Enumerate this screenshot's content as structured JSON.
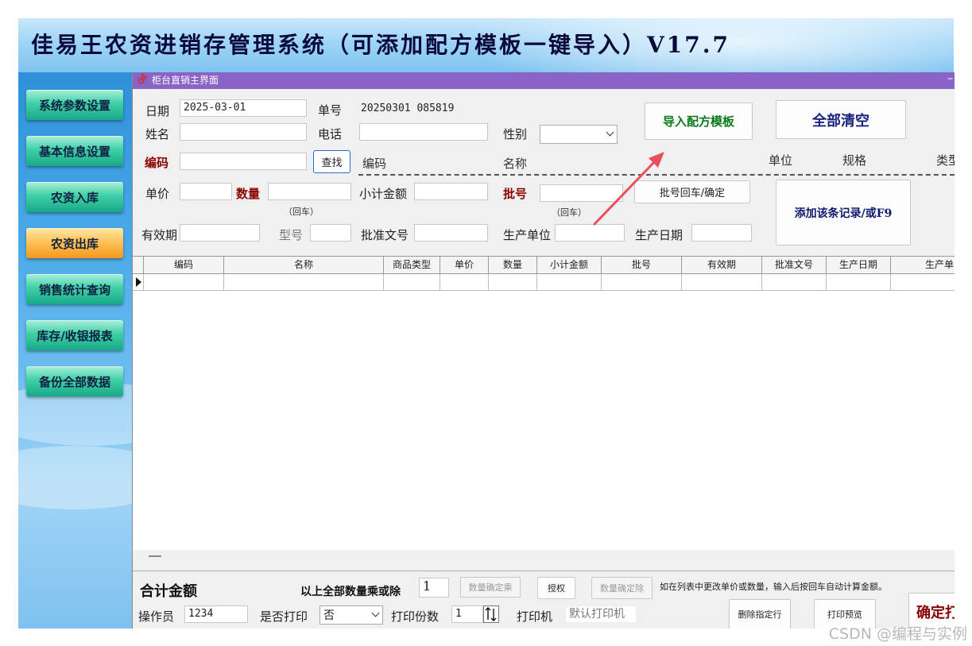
{
  "app": {
    "title": "佳易王农资进销存管理系统（可添加配方模板一键导入）V17.7"
  },
  "sidebar": {
    "items": [
      {
        "label": "系统参数设置"
      },
      {
        "label": "基本信息设置"
      },
      {
        "label": "农资入库"
      },
      {
        "label": "农资出库",
        "active": true
      },
      {
        "label": "销售统计查询"
      },
      {
        "label": "库存/收银报表"
      },
      {
        "label": "备份全部数据"
      }
    ]
  },
  "window": {
    "title": "柜台直销主界面",
    "minimize": "–"
  },
  "form": {
    "date_label": "日期",
    "date_value": "2025-03-01",
    "order_label": "单号",
    "order_value": "20250301 085819",
    "name_label": "姓名",
    "phone_label": "电话",
    "gender_label": "性别",
    "code_label": "编码",
    "find_button": "查找",
    "header_code": "编码",
    "header_name": "名称",
    "header_unit": "单位",
    "header_spec": "规格",
    "header_type": "类型",
    "price_label": "单价",
    "qty_label": "数量",
    "qty_hint": "（回车）",
    "subtotal_label": "小计金额",
    "batch_label": "批号",
    "batch_hint": "（回车）",
    "batch_confirm_button": "批号回车/确定",
    "add_record_button": "添加该条记录/或F9",
    "expiry_label": "有效期",
    "model_label": "型号",
    "approval_label": "批准文号",
    "manufacturer_label": "生产单位",
    "mfg_date_label": "生产日期",
    "import_template_button": "导入配方模板",
    "clear_all_button": "全部清空"
  },
  "grid": {
    "columns": [
      "编码",
      "名称",
      "商品类型",
      "单价",
      "数量",
      "小计金额",
      "批号",
      "有效期",
      "批准文号",
      "生产日期",
      "生产单"
    ]
  },
  "bottom": {
    "total_label": "合计金额",
    "multiply_label": "以上全部数量乘或除",
    "multiply_value": "1",
    "qty_multiply_button": "数量确定乘",
    "authorize_button": "授权",
    "qty_divide_button": "数量确定除",
    "tip": "如在列表中更改单价或数量，输入后按回车自动计算金额。",
    "operator_label": "操作员",
    "operator_value": "1234",
    "print_label": "是否打印",
    "print_value": "否",
    "copies_label": "打印份数",
    "copies_value": "1",
    "printer_label": "打印机",
    "printer_value": "默认打印机",
    "delete_row_button": "删除指定行",
    "print_preview_button": "打印预览",
    "confirm_button": "确定打"
  },
  "watermark": "CSDN @编程与实例",
  "colors": {
    "titlebar": "#8a63c7",
    "nav_button": "#3fd0a8",
    "nav_active": "#f39a1c",
    "annotation_arrow": "#e8505b"
  }
}
